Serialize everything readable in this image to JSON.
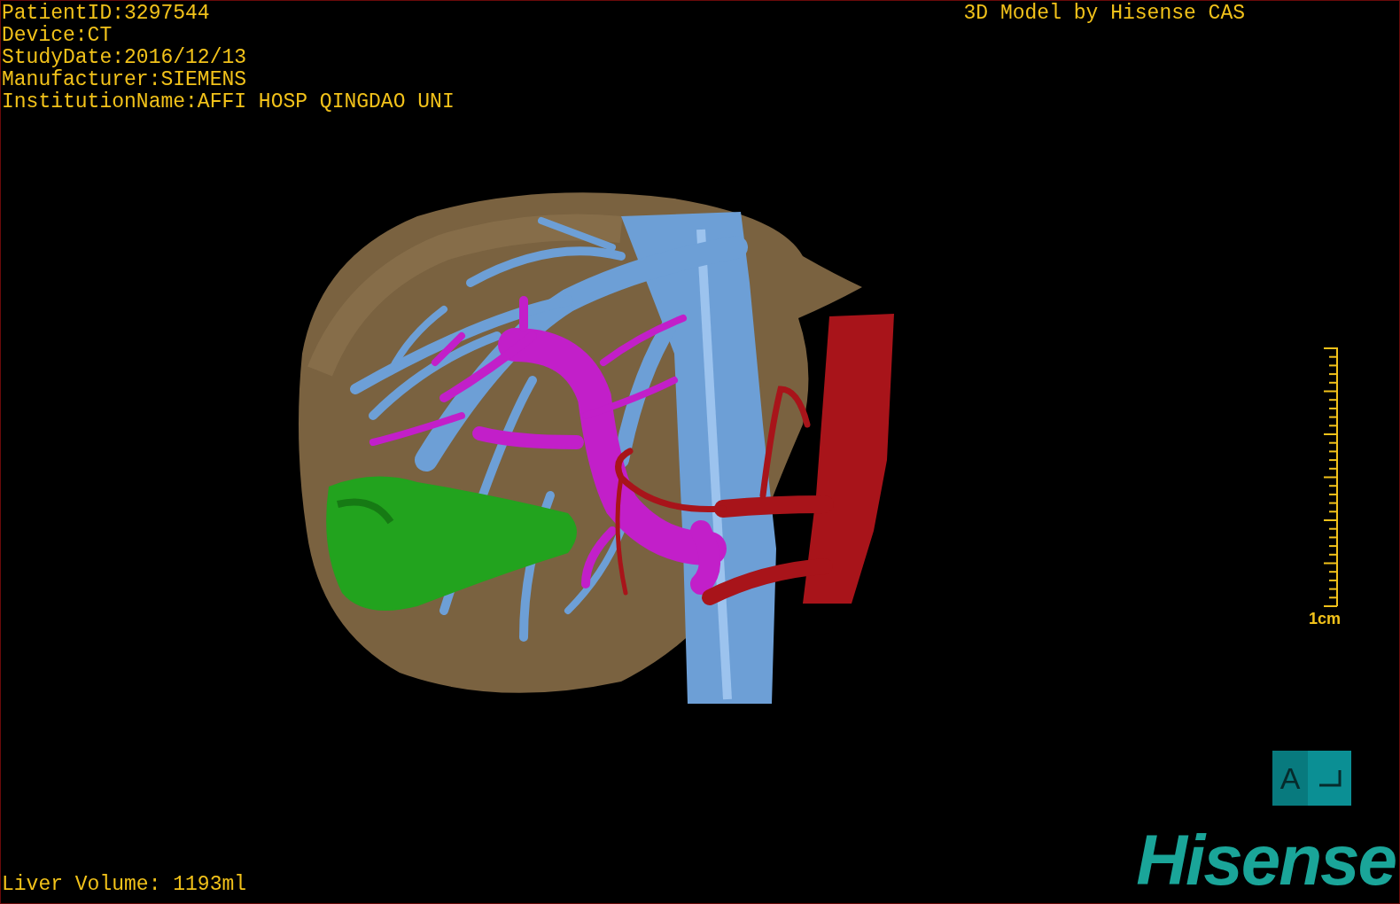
{
  "info_lines": [
    "PatientID:3297544",
    "Device:CT",
    "StudyDate:2016/12/13",
    "Manufacturer:SIEMENS",
    "InstitutionName:AFFI HOSP QINGDAO UNI"
  ],
  "title": "3D Model by Hisense CAS",
  "scale": {
    "label": "1cm"
  },
  "orientation": {
    "label": "A"
  },
  "volume": "Liver Volume: 1193ml",
  "brand": "Hisense"
}
